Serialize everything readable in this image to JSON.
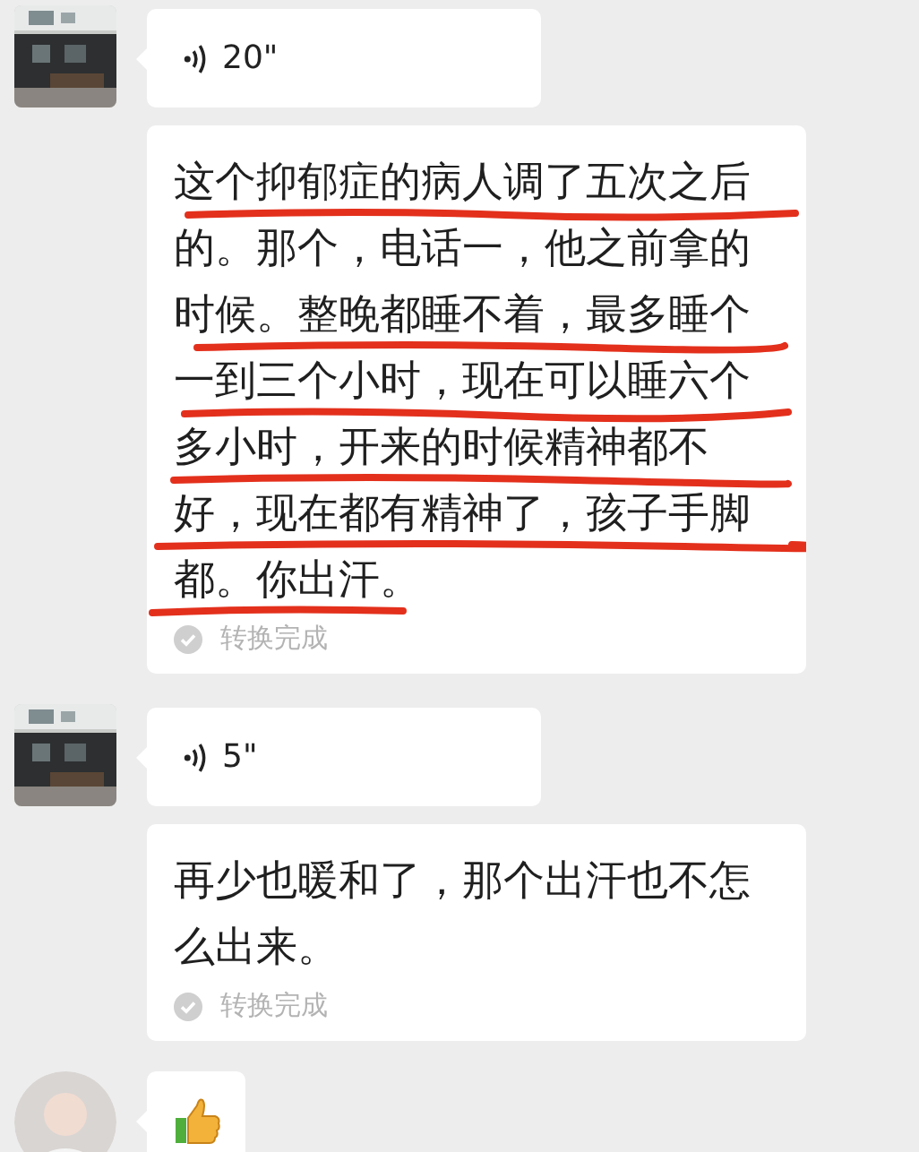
{
  "groups": [
    {
      "avatar": {
        "kind": "picture"
      },
      "messages": [
        {
          "kind": "voice",
          "duration": "20\""
        },
        {
          "kind": "transcript",
          "text": "这个抑郁症的病人调了五次之后的。那个，电话一，他之前拿的时候。整晚都睡不着，最多睡个一到三个小时，现在可以睡六个多小时，开来的时候精神都不好，现在都有精神了，孩子手脚都。你出汗。",
          "status": "转换完成",
          "annotated": true
        }
      ]
    },
    {
      "avatar": {
        "kind": "picture"
      },
      "messages": [
        {
          "kind": "voice",
          "duration": "5\""
        },
        {
          "kind": "transcript",
          "text": "再少也暖和了，那个出汗也不怎么出来。",
          "status": "转换完成"
        }
      ]
    },
    {
      "avatar": {
        "kind": "silhouette"
      },
      "messages": [
        {
          "kind": "sticker"
        }
      ]
    }
  ]
}
